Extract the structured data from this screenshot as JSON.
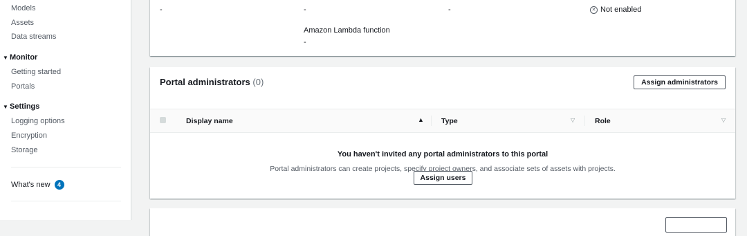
{
  "sidebar": {
    "items_top": [
      "Models",
      "Assets",
      "Data streams"
    ],
    "monitor": {
      "label": "Monitor",
      "items": [
        "Getting started",
        "Portals"
      ]
    },
    "settings": {
      "label": "Settings",
      "items": [
        "Logging options",
        "Encryption",
        "Storage"
      ]
    },
    "whats_new": {
      "label": "What's new",
      "badge": "4"
    }
  },
  "details_panel": {
    "col1_value": "-",
    "col2_value": "-",
    "col3_value": "-",
    "col4_status": "Not enabled",
    "lambda_label": "Amazon Lambda function",
    "lambda_value": "-"
  },
  "admins_panel": {
    "title": "Portal administrators",
    "count": "(0)",
    "assign_button": "Assign administrators",
    "columns": [
      "Display name",
      "Type",
      "Role"
    ],
    "empty_title": "You haven't invited any portal administrators to this portal",
    "empty_desc": "Portal administrators can create projects, specify project owners, and associate sets of assets with projects.",
    "assign_users_button": "Assign users"
  },
  "colors": {
    "accent": "#0073bb",
    "background": "#f2f3f3",
    "text": "#16191f",
    "muted": "#545b64"
  },
  "icons": [
    "collapse-triangle-icon",
    "x-circle-icon",
    "sort-ascending-icon",
    "sort-icon"
  ]
}
